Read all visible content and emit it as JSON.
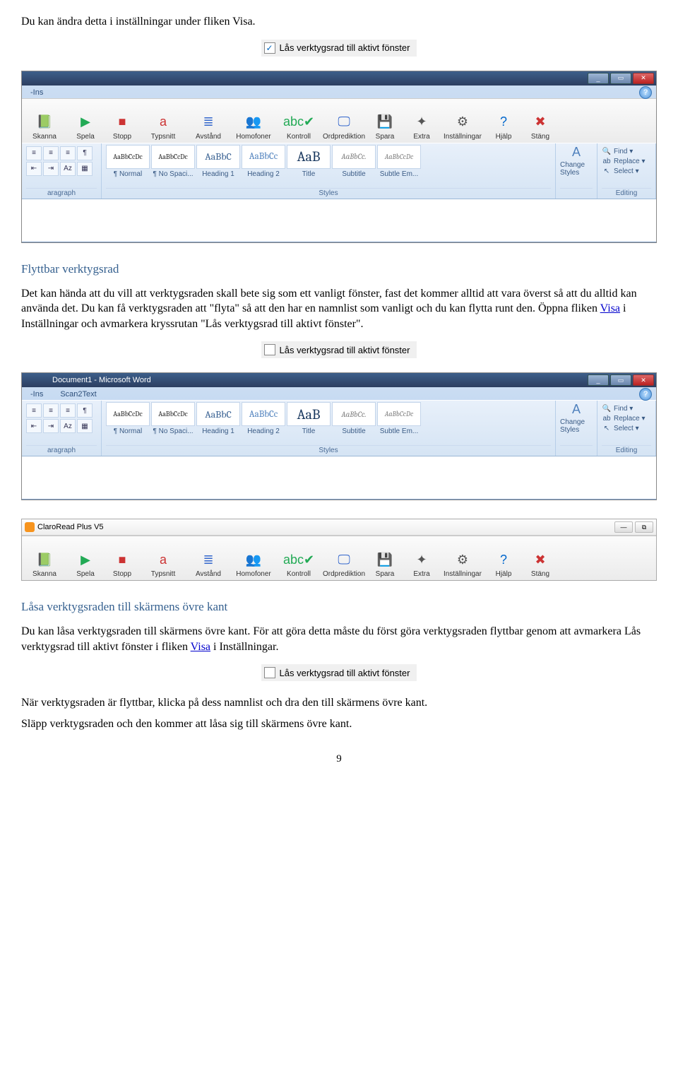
{
  "intro_line": "Du kan ändra detta i inställningar under fliken Visa.",
  "checkbox_label": "Lås verktygsrad till aktivt fönster",
  "section1": {
    "title": "Flyttbar verktygsrad",
    "body_a": "Det kan hända att du vill att verktygsraden skall bete sig som ett vanligt fönster, fast det kommer alltid att vara överst så att du alltid kan använda det. Du kan få verktygsraden att \"flyta\" så att den har en namnlist som vanligt och du kan flytta runt den. Öppna fliken ",
    "link": "Visa",
    "body_b": " i Inställningar och avmarkera kryssrutan \"Lås verktygsrad till aktivt fönster\"."
  },
  "section2": {
    "title": "Låsa verktygsraden till skärmens övre kant",
    "body_a": "Du kan låsa verktygsraden till skärmens övre kant. För att göra detta måste du först göra verktygsraden flyttbar genom att avmarkera Lås verktygsrad till aktivt fönster i fliken ",
    "link": "Visa",
    "body_b": " i Inställningar."
  },
  "para_final1": "När verktygsraden är flyttbar, klicka på dess namnlist och dra den till skärmens övre kant.",
  "para_final2": "Släpp verktygsraden och den kommer att låsa sig till skärmens övre kant.",
  "page_number": "9",
  "word": {
    "title": "Document1 - Microsoft Word",
    "tabs": [
      "-Ins",
      "Scan2Text"
    ],
    "styles": [
      {
        "prev": "AaBbCcDc",
        "name": "¶ Normal",
        "fs": "10px",
        "col": "#222"
      },
      {
        "prev": "AaBbCcDc",
        "name": "¶ No Spaci...",
        "fs": "10px",
        "col": "#222"
      },
      {
        "prev": "AaBbC",
        "name": "Heading 1",
        "fs": "14px",
        "col": "#365f91"
      },
      {
        "prev": "AaBbCc",
        "name": "Heading 2",
        "fs": "13px",
        "col": "#4f81bd"
      },
      {
        "prev": "AaB",
        "name": "Title",
        "fs": "20px",
        "col": "#17365d"
      },
      {
        "prev": "AaBbCc.",
        "name": "Subtitle",
        "fs": "11px",
        "col": "#808080",
        "italic": true
      },
      {
        "prev": "AaBbCcDc",
        "name": "Subtle Em...",
        "fs": "10px",
        "col": "#808080",
        "italic": true
      }
    ],
    "change_styles": "Change Styles",
    "styles_group": "Styles",
    "paragraph_group": "aragraph",
    "editing_group": "Editing",
    "editing_items": [
      "Find",
      "Replace",
      "Select"
    ]
  },
  "claro": {
    "window_title": "ClaroRead Plus V5",
    "buttons": [
      {
        "label": "Skanna",
        "icon": "📗",
        "col": "#2a7"
      },
      {
        "label": "Spela",
        "icon": "▶",
        "col": "#2a5"
      },
      {
        "label": "Stopp",
        "icon": "■",
        "col": "#c33"
      },
      {
        "label": "Typsnitt",
        "icon": "a",
        "col": "#c33"
      },
      {
        "label": "Avstånd",
        "icon": "≣",
        "col": "#36c"
      },
      {
        "label": "Homofoner",
        "icon": "👥",
        "col": "#555"
      },
      {
        "label": "Kontroll",
        "icon": "abc✔",
        "col": "#2a5"
      },
      {
        "label": "Ordprediktion",
        "icon": "🖵",
        "col": "#36c"
      },
      {
        "label": "Spara",
        "icon": "💾",
        "col": "#36c"
      },
      {
        "label": "Extra",
        "icon": "✦",
        "col": "#555"
      },
      {
        "label": "Inställningar",
        "icon": "⚙",
        "col": "#555"
      },
      {
        "label": "Hjälp",
        "icon": "?",
        "col": "#06c"
      },
      {
        "label": "Stäng",
        "icon": "✖",
        "col": "#c33"
      }
    ]
  }
}
